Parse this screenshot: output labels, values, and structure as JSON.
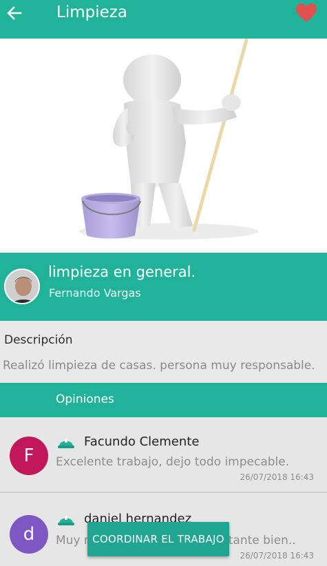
{
  "header": {
    "title": "Limpieza",
    "back_icon": "arrow-left-icon",
    "favorite_icon": "heart-icon",
    "accent_color": "#20b39a",
    "favorite_color": "#e0504f"
  },
  "service": {
    "title": "limpieza en general.",
    "owner_name": "Fernando Vargas",
    "image_alt": "cleaning-person-illustration"
  },
  "description": {
    "label": "Descripción",
    "text": "Realizó limpieza de casas. persona muy responsable."
  },
  "opinions": {
    "title": "Opiniones",
    "items": [
      {
        "initial": "F",
        "avatar_color": "#c2185b",
        "name": "Facundo Clemente",
        "comment": "Excelente trabajo, dejo todo impecable.",
        "date": "26/07/2018 16:43"
      },
      {
        "initial": "d",
        "avatar_color": "#7e57c2",
        "name": "daniel hernandez",
        "comment": "Muy responsable, trabaja bastante bien..",
        "date": "26/07/2018 16:43"
      }
    ]
  },
  "actions": {
    "coordinate_label": "COORDINAR EL TRABAJO"
  }
}
